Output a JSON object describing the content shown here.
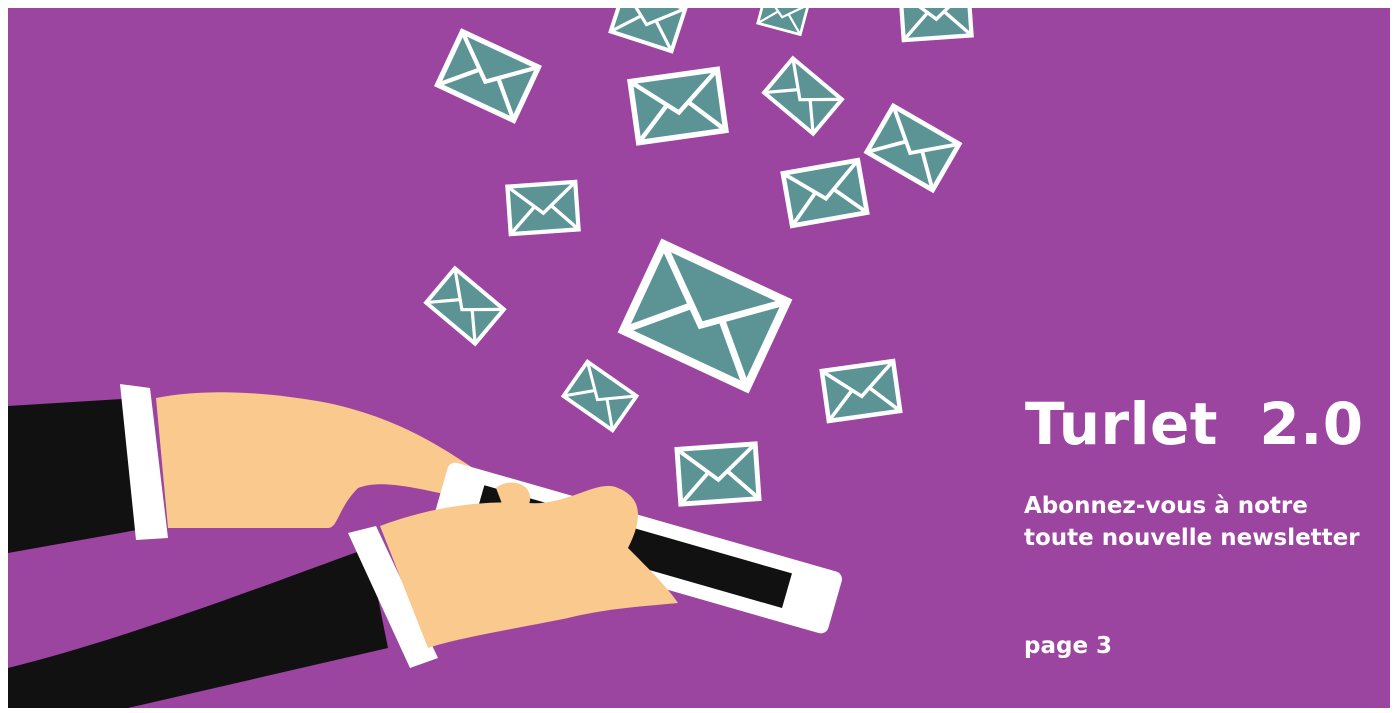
{
  "banner": {
    "title": "Turlet  2.0",
    "subtitle": "Abonnez-vous à notre toute nouvelle newsletter",
    "page_ref": "page 3"
  },
  "colors": {
    "background": "#9b44a0",
    "envelope_fill": "#5c9496",
    "envelope_stroke": "#ffffff",
    "skin": "#f9c98d",
    "sleeve": "#111111",
    "cuff": "#ffffff"
  },
  "illustration": {
    "subject": "hands typing on a smartphone sending email envelopes",
    "icon": "envelope-icon"
  }
}
